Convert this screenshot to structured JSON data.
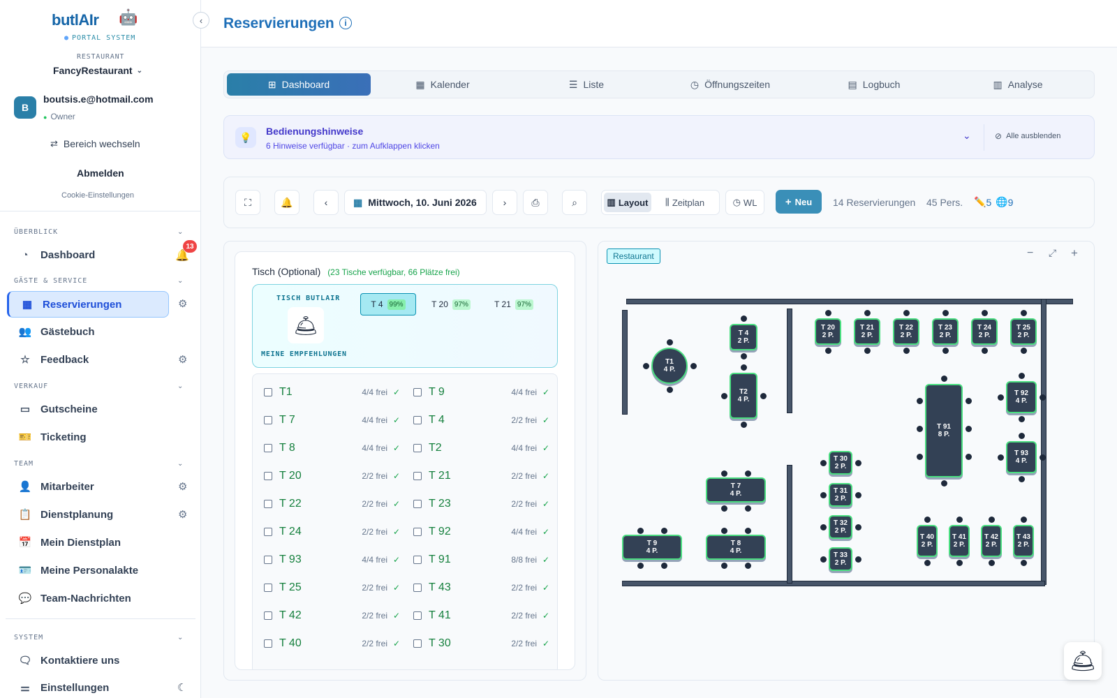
{
  "sidebar": {
    "brand": "butlAIr",
    "brand_sub": "PORTAL SYSTEM",
    "restaurant_label": "RESTAURANT",
    "restaurant_name": "FancyRestaurant",
    "user": {
      "initial": "B",
      "email": "boutsis.e@hotmail.com",
      "role": "Owner"
    },
    "switch_area": "Bereich wechseln",
    "logout": "Abmelden",
    "cookie": "Cookie-Einstellungen",
    "sections": {
      "overview": "ÜBERBLICK",
      "guests": "GÄSTE & SERVICE",
      "sales": "VERKAUF",
      "team": "TEAM",
      "system": "SYSTEM"
    },
    "notification_count": "13",
    "items": {
      "dashboard": "Dashboard",
      "reservierungen": "Reservierungen",
      "gaestebuch": "Gästebuch",
      "feedback": "Feedback",
      "gutscheine": "Gutscheine",
      "ticketing": "Ticketing",
      "mitarbeiter": "Mitarbeiter",
      "dienstplanung": "Dienstplanung",
      "mein_dienstplan": "Mein Dienstplan",
      "personalakte": "Meine Personalakte",
      "nachrichten": "Team-Nachrichten",
      "kontakt": "Kontaktiere uns",
      "einstellungen": "Einstellungen"
    }
  },
  "header": {
    "title": "Reservierungen"
  },
  "tabs": [
    {
      "label": "Dashboard",
      "icon": "grid-icon"
    },
    {
      "label": "Kalender",
      "icon": "calendar-icon"
    },
    {
      "label": "Liste",
      "icon": "list-icon"
    },
    {
      "label": "Öffnungszeiten",
      "icon": "clock-icon"
    },
    {
      "label": "Logbuch",
      "icon": "document-icon"
    },
    {
      "label": "Analyse",
      "icon": "bar-chart-icon"
    }
  ],
  "hints": {
    "title": "Bedienungshinweise",
    "subtitle": "6 Hinweise verfügbar · zum Aufklappen klicken",
    "hide_all": "Alle ausblenden"
  },
  "toolbar": {
    "date": "Mittwoch, 10. Juni 2026",
    "layout": "Layout",
    "timeline": "Zeitplan",
    "waitlist": "WL",
    "new": "Neu",
    "reservations": "14 Reservierungen",
    "persons": "45 Pers.",
    "edit_count": "5",
    "web_count": "9"
  },
  "table_panel": {
    "label": "Tisch (Optional)",
    "availability": "(23 Tische verfügbar, 66 Plätze frei)",
    "recommend_title": "TISCH BUTLAIR",
    "recommend_sub": "MEINE EMPFEHLUNGEN",
    "recommendations": [
      {
        "name": "T 4",
        "score": "99%"
      },
      {
        "name": "T 20",
        "score": "97%"
      },
      {
        "name": "T 21",
        "score": "97%"
      }
    ],
    "rows": [
      [
        {
          "name": "T1",
          "free": "4/4 frei"
        },
        {
          "name": "T 9",
          "free": "4/4 frei"
        }
      ],
      [
        {
          "name": "T 7",
          "free": "4/4 frei"
        },
        {
          "name": "T 4",
          "free": "2/2 frei"
        }
      ],
      [
        {
          "name": "T 8",
          "free": "4/4 frei"
        },
        {
          "name": "T2",
          "free": "4/4 frei"
        }
      ],
      [
        {
          "name": "T 20",
          "free": "2/2 frei"
        },
        {
          "name": "T 21",
          "free": "2/2 frei"
        }
      ],
      [
        {
          "name": "T 22",
          "free": "2/2 frei"
        },
        {
          "name": "T 23",
          "free": "2/2 frei"
        }
      ],
      [
        {
          "name": "T 24",
          "free": "2/2 frei"
        },
        {
          "name": "T 92",
          "free": "4/4 frei"
        }
      ],
      [
        {
          "name": "T 93",
          "free": "4/4 frei"
        },
        {
          "name": "T 91",
          "free": "8/8 frei"
        }
      ],
      [
        {
          "name": "T 25",
          "free": "2/2 frei"
        },
        {
          "name": "T 43",
          "free": "2/2 frei"
        }
      ],
      [
        {
          "name": "T 42",
          "free": "2/2 frei"
        },
        {
          "name": "T 41",
          "free": "2/2 frei"
        }
      ],
      [
        {
          "name": "T 40",
          "free": "2/2 frei"
        },
        {
          "name": "T 30",
          "free": "2/2 frei"
        }
      ]
    ]
  },
  "floorplan": {
    "room": "Restaurant",
    "tables": [
      {
        "name": "T1",
        "pax": "4 P."
      },
      {
        "name": "T 4",
        "pax": "2 P."
      },
      {
        "name": "T2",
        "pax": "4 P."
      },
      {
        "name": "T 20",
        "pax": "2 P."
      },
      {
        "name": "T 21",
        "pax": "2 P."
      },
      {
        "name": "T 22",
        "pax": "2 P."
      },
      {
        "name": "T 23",
        "pax": "2 P."
      },
      {
        "name": "T 24",
        "pax": "2 P."
      },
      {
        "name": "T 25",
        "pax": "2 P."
      },
      {
        "name": "T 92",
        "pax": "4 P."
      },
      {
        "name": "T 91",
        "pax": "8 P."
      },
      {
        "name": "T 93",
        "pax": "4 P."
      },
      {
        "name": "T 30",
        "pax": "2 P."
      },
      {
        "name": "T 31",
        "pax": "2 P."
      },
      {
        "name": "T 32",
        "pax": "2 P."
      },
      {
        "name": "T 33",
        "pax": "2 P."
      },
      {
        "name": "T 7",
        "pax": "4 P."
      },
      {
        "name": "T 9",
        "pax": "4 P."
      },
      {
        "name": "T 8",
        "pax": "4 P."
      },
      {
        "name": "T 40",
        "pax": "2 P."
      },
      {
        "name": "T 41",
        "pax": "2 P."
      },
      {
        "name": "T 42",
        "pax": "2 P."
      },
      {
        "name": "T 43",
        "pax": "2 P."
      }
    ]
  },
  "colors": {
    "accent": "#2a7fa8",
    "available": "#4ade80",
    "table": "#334155"
  }
}
